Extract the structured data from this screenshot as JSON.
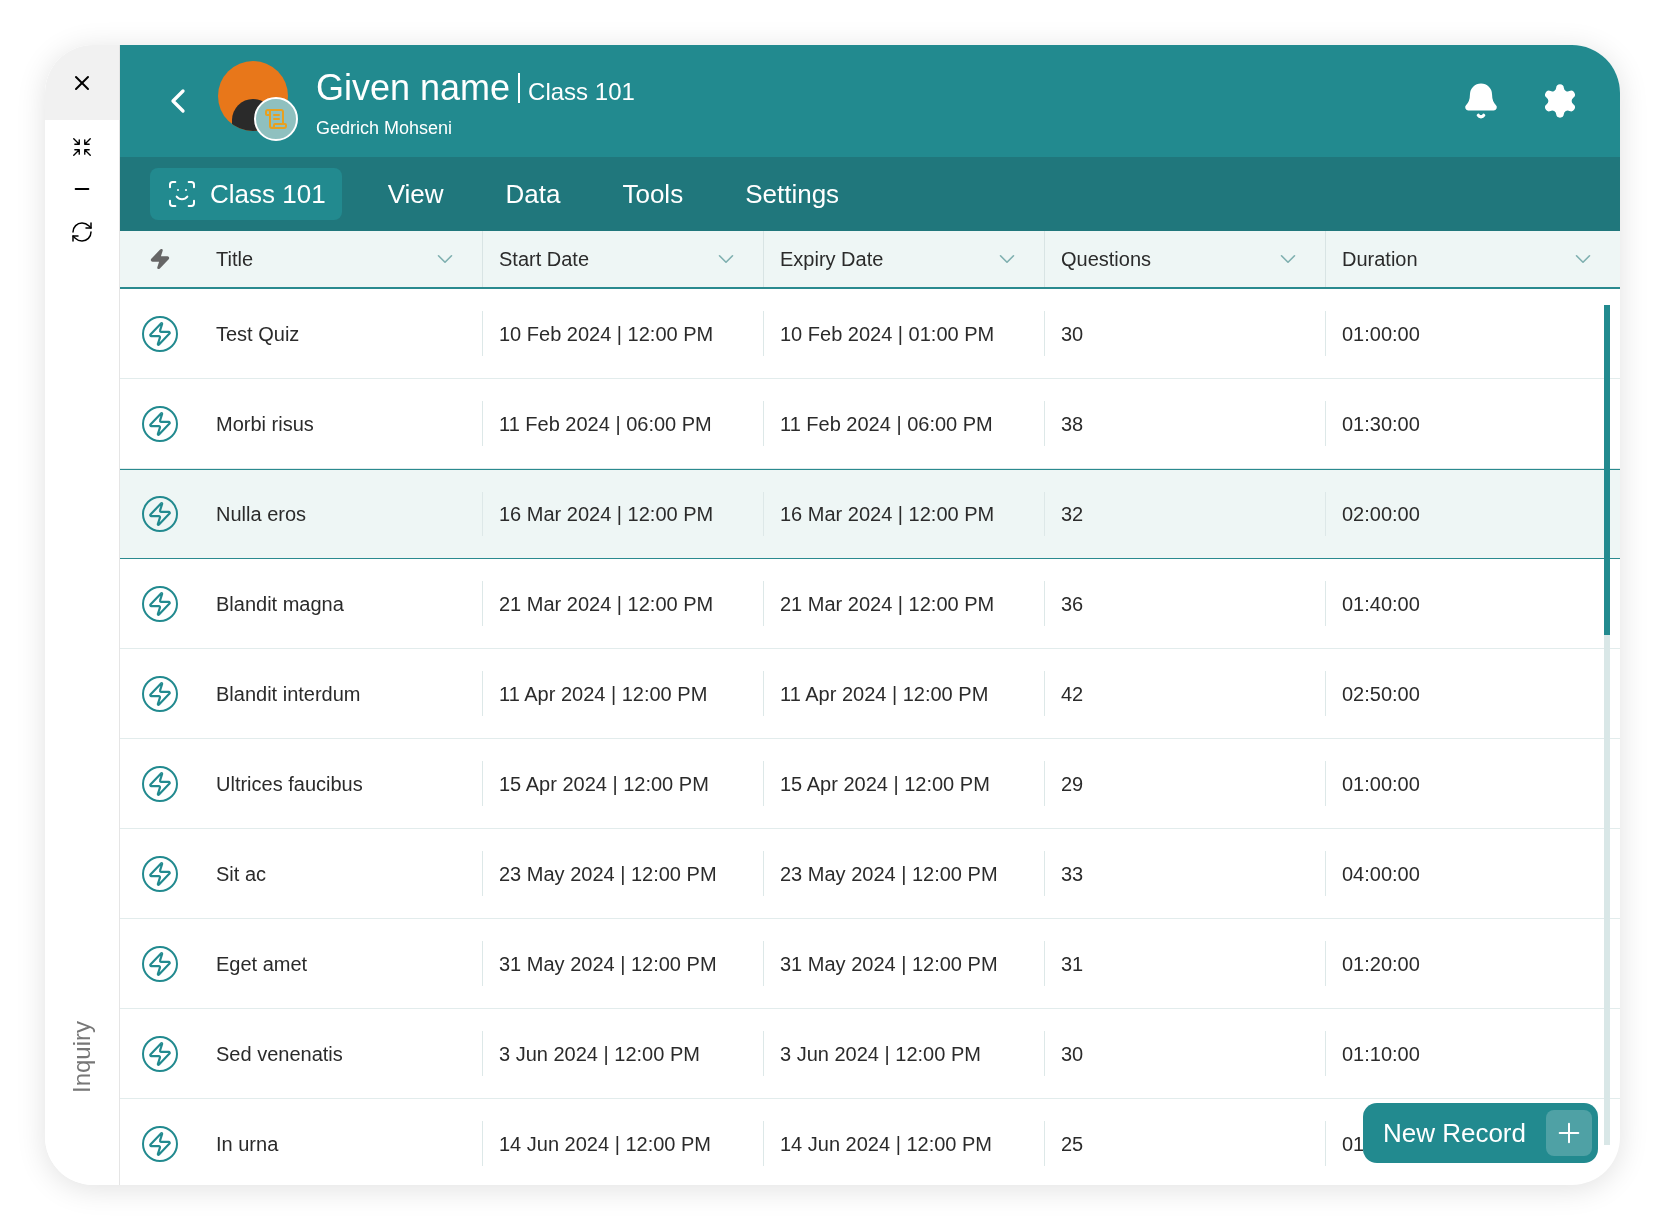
{
  "rail": {
    "label": "Inquiry"
  },
  "header": {
    "title": "Given name",
    "subtitle": "Class 101",
    "user": "Gedrich Mohseni"
  },
  "nav": [
    {
      "label": "Class 101",
      "selected": true
    },
    {
      "label": "View",
      "selected": false
    },
    {
      "label": "Data",
      "selected": false
    },
    {
      "label": "Tools",
      "selected": false
    },
    {
      "label": "Settings",
      "selected": false
    }
  ],
  "table": {
    "columns": [
      "Title",
      "Start Date",
      "Expiry Date",
      "Questions",
      "Duration"
    ],
    "rows": [
      {
        "title": "Test Quiz",
        "start": "10 Feb 2024 | 12:00 PM",
        "expiry": "10 Feb 2024 | 01:00 PM",
        "questions": "30",
        "duration": "01:00:00",
        "selected": false
      },
      {
        "title": "Morbi risus",
        "start": "11 Feb 2024 | 06:00 PM",
        "expiry": "11 Feb 2024 | 06:00 PM",
        "questions": "38",
        "duration": "01:30:00",
        "selected": false
      },
      {
        "title": "Nulla eros",
        "start": "16 Mar 2024 | 12:00 PM",
        "expiry": "16 Mar 2024 | 12:00 PM",
        "questions": "32",
        "duration": "02:00:00",
        "selected": true
      },
      {
        "title": "Blandit magna",
        "start": "21 Mar 2024 | 12:00 PM",
        "expiry": "21 Mar 2024 | 12:00 PM",
        "questions": "36",
        "duration": "01:40:00",
        "selected": false
      },
      {
        "title": "Blandit interdum",
        "start": "11 Apr 2024 | 12:00 PM",
        "expiry": "11 Apr 2024 | 12:00 PM",
        "questions": "42",
        "duration": "02:50:00",
        "selected": false
      },
      {
        "title": "Ultrices faucibus",
        "start": "15 Apr 2024 | 12:00 PM",
        "expiry": "15 Apr 2024 | 12:00 PM",
        "questions": "29",
        "duration": "01:00:00",
        "selected": false
      },
      {
        "title": "Sit ac",
        "start": "23 May 2024 | 12:00 PM",
        "expiry": "23 May 2024 | 12:00 PM",
        "questions": "33",
        "duration": "04:00:00",
        "selected": false
      },
      {
        "title": "Eget amet",
        "start": "31 May 2024 | 12:00 PM",
        "expiry": "31 May 2024 | 12:00 PM",
        "questions": "31",
        "duration": "01:20:00",
        "selected": false
      },
      {
        "title": "Sed venenatis",
        "start": "3 Jun 2024 | 12:00 PM",
        "expiry": "3 Jun 2024 | 12:00 PM",
        "questions": "30",
        "duration": "01:10:00",
        "selected": false
      },
      {
        "title": "In urna",
        "start": "14 Jun 2024 | 12:00 PM",
        "expiry": "14 Jun 2024 | 12:00 PM",
        "questions": "25",
        "duration": "01",
        "selected": false
      }
    ]
  },
  "fab": {
    "label": "New Record"
  }
}
